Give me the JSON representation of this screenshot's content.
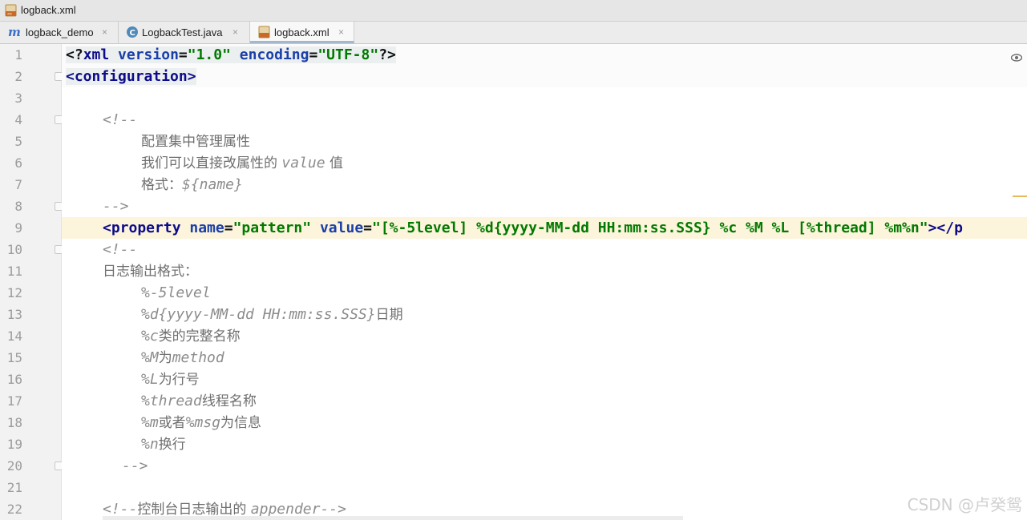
{
  "window": {
    "title": "logback.xml",
    "file_icon": "xml-file-icon"
  },
  "tabs": [
    {
      "label": "logback_demo",
      "icon": "module-icon",
      "close": "×",
      "active": false
    },
    {
      "label": "LogbackTest.java",
      "icon": "java-class-icon",
      "close": "×",
      "active": false
    },
    {
      "label": "logback.xml",
      "icon": "xml-file-icon",
      "close": "×",
      "active": true
    }
  ],
  "editor": {
    "line_numbers": [
      "1",
      "2",
      "3",
      "4",
      "5",
      "6",
      "7",
      "8",
      "9",
      "10",
      "11",
      "12",
      "13",
      "14",
      "15",
      "16",
      "17",
      "18",
      "19",
      "20",
      "21",
      "22"
    ],
    "lines": {
      "l1": {
        "a": "<?",
        "b": "xml ",
        "c": "version",
        "d": "=",
        "e": "\"1.0\"",
        "f": " ",
        "g": "encoding",
        "h": "=",
        "i": "\"UTF-8\"",
        "j": "?>"
      },
      "l2": {
        "a": "<configuration>"
      },
      "l4": {
        "a": "<!--"
      },
      "l5": {
        "a": "配置集中管理属性"
      },
      "l6": {
        "a": "我们可以直接改属性的 ",
        "b": "value",
        "c": " 值"
      },
      "l7": {
        "a": "格式：",
        "b": "${name}"
      },
      "l8": {
        "a": "-->"
      },
      "l9": {
        "a": "<property ",
        "b": "name",
        "c": "=",
        "d": "\"pattern\"",
        "e": " ",
        "f": "value",
        "g": "=",
        "h": "\"[%-5level] %d{yyyy-MM-dd HH:mm:ss.SSS} %c %M %L [%thread] %m%n\"",
        "i": "></p"
      },
      "l10": {
        "a": "<!--"
      },
      "l11": {
        "a": "日志输出格式："
      },
      "l12": {
        "a": "%-5level"
      },
      "l13": {
        "a": "%d{yyyy-MM-dd HH:mm:ss.SSS}",
        "b": "日期"
      },
      "l14": {
        "a": "%c",
        "b": "类的完整名称"
      },
      "l15": {
        "a": "%M",
        "b": "为",
        "c": "method"
      },
      "l16": {
        "a": "%L",
        "b": "为行号"
      },
      "l17": {
        "a": "%thread",
        "b": "线程名称"
      },
      "l18": {
        "a": "%m",
        "b": "或者",
        "c": "%msg",
        "d": "为信息"
      },
      "l19": {
        "a": "%n",
        "b": "换行"
      },
      "l20": {
        "a": "-->"
      },
      "l22": {
        "a": "<!--",
        "b": "控制台日志输出的 ",
        "c": "appender-->"
      }
    }
  },
  "watermark": "CSDN @卢癸鸳",
  "colors": {
    "tag": "#0c0c8a",
    "attribute": "#1a3fa8",
    "string": "#007a00",
    "comment": "#8c8c8c",
    "current_line": "#fdf4dc",
    "active_tab_underline": "#a5b6cf"
  }
}
